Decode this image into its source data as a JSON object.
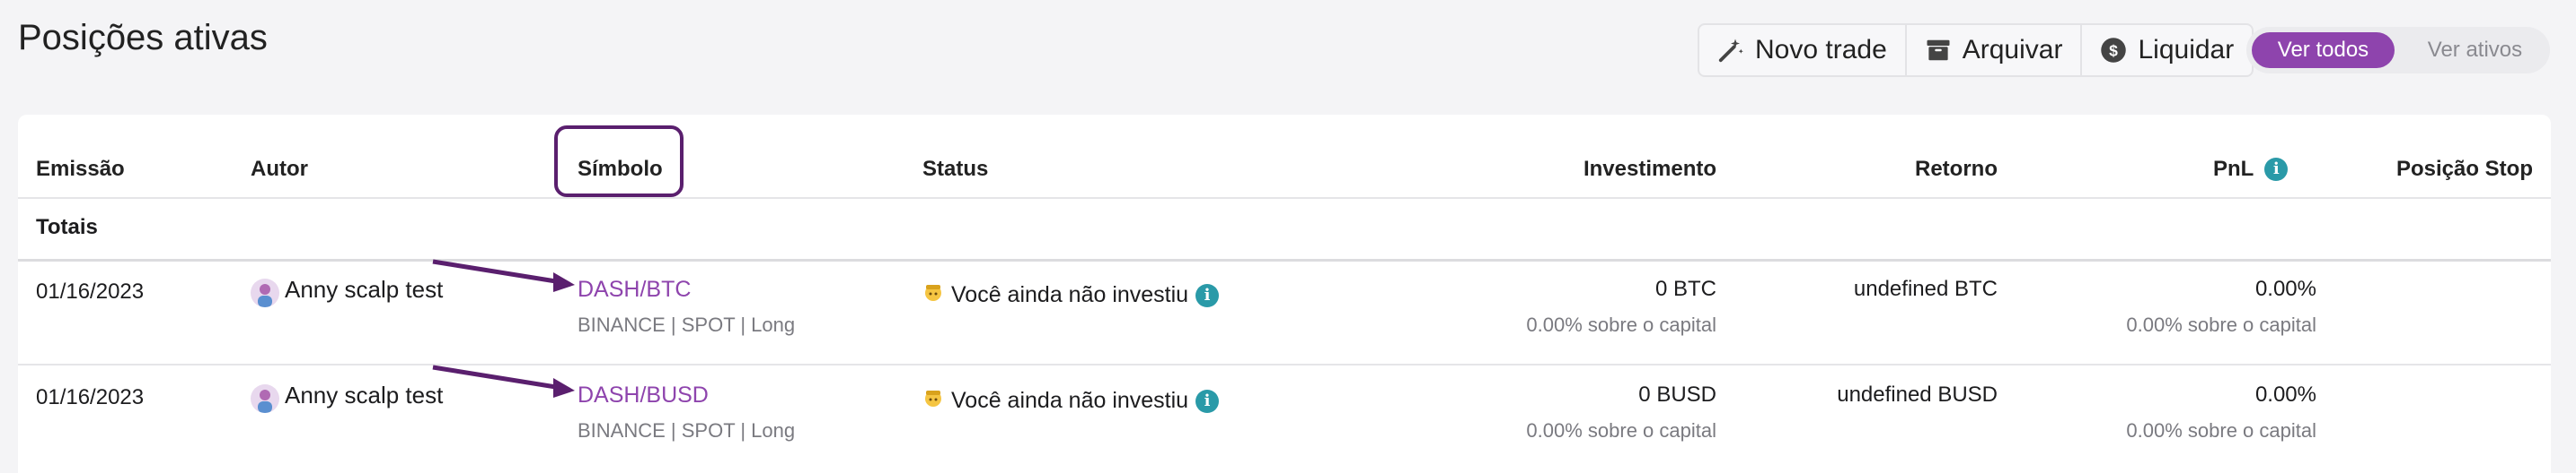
{
  "page": {
    "title": "Posições ativas"
  },
  "toolbar": {
    "new_trade": "Novo trade",
    "archive": "Arquivar",
    "liquidate": "Liquidar"
  },
  "filter": {
    "all": "Ver todos",
    "active": "Ver ativos",
    "selected": "Ver todos"
  },
  "colors": {
    "accent": "#8e44ad",
    "info": "#2a9aa8",
    "annotation": "#5a1f6e"
  },
  "table": {
    "headers": {
      "emission": "Emissão",
      "author": "Autor",
      "symbol": "Símbolo",
      "status": "Status",
      "investment": "Investimento",
      "return": "Retorno",
      "pnl": "PnL",
      "stop": "Posição Stop"
    },
    "totals_label": "Totais",
    "rows": [
      {
        "date": "01/16/2023",
        "author": "Anny scalp test",
        "symbol": "DASH/BTC",
        "symbol_meta": "BINANCE | SPOT | Long",
        "status": "Você ainda não investiu",
        "investment": "0 BTC",
        "investment_sub": "0.00% sobre o capital",
        "return": "undefined BTC",
        "pnl": "0.00%",
        "pnl_sub": "0.00% sobre o capital"
      },
      {
        "date": "01/16/2023",
        "author": "Anny scalp test",
        "symbol": "DASH/BUSD",
        "symbol_meta": "BINANCE | SPOT | Long",
        "status": "Você ainda não investiu",
        "investment": "0 BUSD",
        "investment_sub": "0.00% sobre o capital",
        "return": "undefined BUSD",
        "pnl": "0.00%",
        "pnl_sub": "0.00% sobre o capital"
      }
    ]
  },
  "icons": {
    "new_trade": "magic-wand-icon",
    "archive": "archive-box-icon",
    "liquidate": "dollar-circle-icon",
    "info": "info-icon",
    "status": "hand-emoji-icon"
  }
}
